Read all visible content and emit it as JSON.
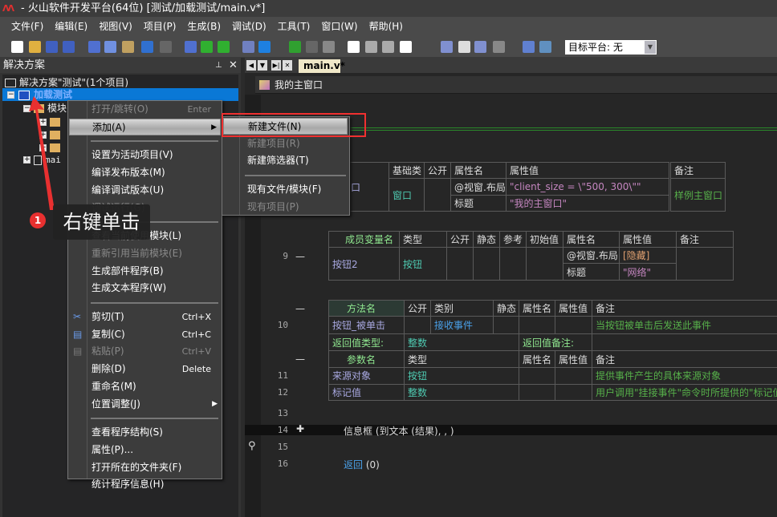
{
  "title": "- 火山软件开发平台(64位) [测试/加载测试/main.v*]",
  "logo": "AA",
  "menu": [
    "文件(F)",
    "编辑(E)",
    "视图(V)",
    "项目(P)",
    "生成(B)",
    "调试(D)",
    "工具(T)",
    "窗口(W)",
    "帮助(H)"
  ],
  "toolbar": {
    "target_platform": "目标平台: 无"
  },
  "solution_panel": {
    "title": "解决方案",
    "pin": "ᵖ",
    "close": "✕",
    "tree": {
      "solution": "解决方案\"测试\"(1个项目)",
      "project": "加载测试",
      "module_folder": "模块",
      "main_file": "mai"
    }
  },
  "context_menu": [
    {
      "label": "打开/跳转(O)",
      "shortcut": "Enter",
      "disabled": true
    },
    {
      "label": "添加(A)",
      "submenu": true,
      "highlight": true
    },
    {
      "sep": true
    },
    {
      "label": "设置为活动项目(V)"
    },
    {
      "label": "编译发布版本(M)"
    },
    {
      "label": "编译调试版本(U)"
    },
    {
      "label": "调试运行(G)",
      "disabled": true
    },
    {
      "sep": true
    },
    {
      "label": "查看当前使用模块(L)"
    },
    {
      "label": "重新引用当前模块(E)",
      "disabled": true
    },
    {
      "label": "生成部件程序(B)"
    },
    {
      "label": "生成文本程序(W)"
    },
    {
      "sep": true
    },
    {
      "label": "剪切(T)",
      "shortcut": "Ctrl+X",
      "icon": "scissors-icon"
    },
    {
      "label": "复制(C)",
      "shortcut": "Ctrl+C",
      "icon": "copy-icon"
    },
    {
      "label": "粘贴(P)",
      "shortcut": "Ctrl+V",
      "disabled": true,
      "icon": "paste-icon"
    },
    {
      "label": "删除(D)",
      "shortcut": "Delete"
    },
    {
      "label": "重命名(M)"
    },
    {
      "label": "位置调整(J)",
      "submenu": true
    },
    {
      "sep": true
    },
    {
      "label": "查看程序结构(S)"
    },
    {
      "label": "属性(P)..."
    },
    {
      "label": "打开所在的文件夹(F)"
    },
    {
      "label": "统计程序信息(H)"
    }
  ],
  "submenu": [
    {
      "label": "新建文件(N)",
      "highlight": true
    },
    {
      "label": "新建项目(R)",
      "disabled": true
    },
    {
      "label": "新建筛选器(T)"
    },
    {
      "sep": true
    },
    {
      "label": "现有文件/模块(F)"
    },
    {
      "label": "现有项目(P)",
      "disabled": true
    }
  ],
  "annotation": {
    "number": "1",
    "text": "右键单击",
    "color": "#e83030"
  },
  "editor": {
    "tab": "main.v*",
    "object": "我的主窗口",
    "class_table": {
      "headers": [
        "基础类",
        "公开",
        "属性名",
        "属性值",
        "备注"
      ],
      "name": "窗口",
      "base": "窗口",
      "prop1": "@视窗.布局",
      "val1": "\"client_size = \\\"500, 300\\\"\"",
      "prop2": "标题",
      "val2": "\"我的主窗口\"",
      "note": "样例主窗口"
    },
    "member_table": {
      "headers": [
        "成员变量名",
        "类型",
        "公开",
        "静态",
        "参考",
        "初始值",
        "属性名",
        "属性值",
        "备注"
      ],
      "line": "9",
      "name": "按钮2",
      "type": "按钮",
      "prop1": "@视窗.布局",
      "val1": "[隐藏]",
      "prop2": "标题",
      "val2": "\"网络\""
    },
    "method_table": {
      "headers": [
        "方法名",
        "公开",
        "类别",
        "静态",
        "属性名",
        "属性值",
        "备注"
      ],
      "line": "10",
      "name": "按钮_被单击",
      "category": "接收事件",
      "note": "当按钮被单击后发送此事件",
      "ret_type_label": "返回值类型:",
      "ret_type": "整数",
      "ret_note_label": "返回值备注:"
    },
    "param_table": {
      "headers": [
        "参数名",
        "类型",
        "属性名",
        "属性值",
        "备注"
      ],
      "rows": [
        {
          "line": "11",
          "name": "来源对象",
          "type": "按钮",
          "note": "提供事件产生的具体来源对象"
        },
        {
          "line": "12",
          "name": "标记值",
          "type": "整数",
          "note": "用户调用\"挂接事件\"命令时所提供的\"标记值\""
        }
      ]
    },
    "code": [
      {
        "line": "13",
        "text": ""
      },
      {
        "line": "14",
        "text": "信息框 (到文本 (结果), , )"
      },
      {
        "line": "15",
        "text": ""
      },
      {
        "line": "16",
        "kw": "返回",
        "text": " (0)"
      }
    ],
    "collapse": "—"
  }
}
